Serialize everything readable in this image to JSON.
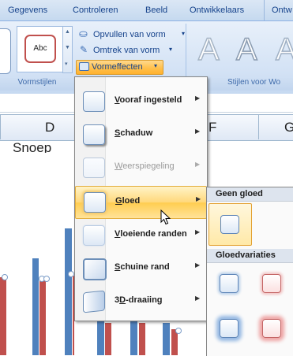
{
  "ribbon": {
    "tabs": [
      "Gegevens",
      "Controleren",
      "Beeld",
      "Ontwikkelaars",
      "Ontw"
    ],
    "shape_fill": "Opvullen van vorm",
    "shape_outline": "Omtrek van vorm",
    "shape_effects": "Vormeffecten",
    "style_preview": "Abc",
    "group_shape_styles": "Vormstijlen",
    "group_wordart": "Stijlen voor Wo",
    "wordart_letters": [
      "A",
      "A",
      "A"
    ]
  },
  "sheet": {
    "columns": [
      "D",
      "F",
      "G"
    ],
    "cell_text": "Snoep"
  },
  "menu": {
    "items": [
      {
        "label": "Vooraf ingesteld",
        "accel": "V"
      },
      {
        "label": "Schaduw",
        "accel": "S"
      },
      {
        "label": "Weerspiegeling",
        "accel": "W"
      },
      {
        "label": "Gloed",
        "accel": "G"
      },
      {
        "label": "Vloeiende randen",
        "accel": "V"
      },
      {
        "label": "Schuine rand",
        "accel": "S"
      },
      {
        "label": "3D-draaiing",
        "accel": "D"
      }
    ]
  },
  "submenu": {
    "no_glow_header": "Geen gloed",
    "variations_header": "Gloedvariaties",
    "glow_colors": [
      "#5b9bd5",
      "#e36c6c",
      "#5b9bd5",
      "#e36c6c"
    ]
  },
  "chart": {
    "bar_colors": [
      "#4f81bd",
      "#c0504d"
    ]
  }
}
